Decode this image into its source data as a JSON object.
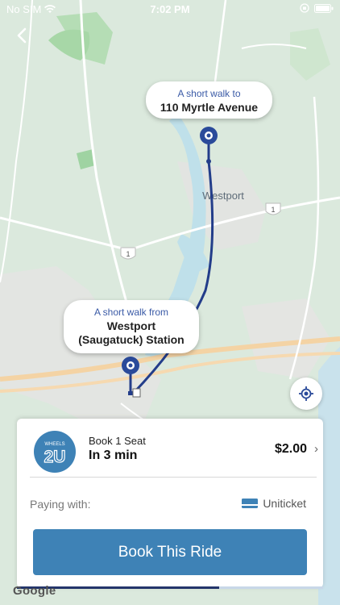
{
  "status_bar": {
    "carrier": "No SIM",
    "time": "7:02 PM"
  },
  "map": {
    "city_label": "Westport",
    "route_badge": "1",
    "map_attribution": "Google",
    "colors": {
      "route": "#233d8a",
      "pin": "#2a4a9a",
      "water": "#bfe0ea",
      "park": "#a8d9a8",
      "road": "#f3c997"
    }
  },
  "destination_bubble": {
    "subtitle": "A short walk to",
    "title": "110 Myrtle Avenue"
  },
  "origin_bubble": {
    "subtitle": "A short walk from",
    "title_line1": "Westport",
    "title_line2": "(Saugatuck) Station"
  },
  "ride_card": {
    "logo_text_top": "WHEELS",
    "logo_text_main": "2U",
    "seat_label": "Book 1 Seat",
    "eta": "In 3 min",
    "price": "$2.00",
    "paying_label": "Paying with:",
    "payment_method": "Uniticket",
    "book_button_label": "Book This Ride",
    "progress_fraction": 0.66
  }
}
